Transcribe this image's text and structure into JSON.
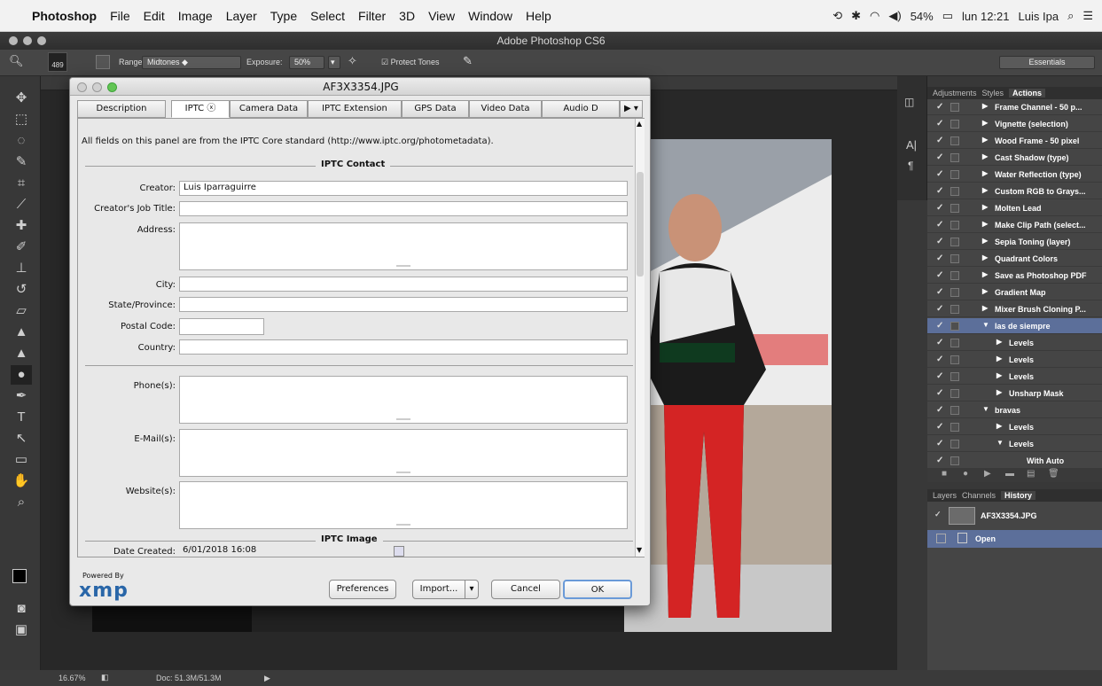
{
  "menubar": {
    "apple": "",
    "items": [
      "Photoshop",
      "File",
      "Edit",
      "Image",
      "Layer",
      "Type",
      "Select",
      "Filter",
      "3D",
      "View",
      "Window",
      "Help"
    ],
    "battery": "54%",
    "clock": "lun 12:21",
    "user": "Luis Ipa"
  },
  "window": {
    "title": "Adobe Photoshop CS6"
  },
  "options": {
    "brush_size": "489",
    "range_label": "Range:",
    "range_value": "Midtones",
    "exposure_label": "Exposure:",
    "exposure_value": "50%",
    "protect_tones": "Protect Tones",
    "workspace": "Essentials"
  },
  "status": {
    "zoom": "16.67%",
    "doc": "Doc: 51.3M/51.3M"
  },
  "panels": {
    "tabs": [
      "Adjustments",
      "Styles",
      "Actions"
    ],
    "actions": [
      {
        "label": "Frame Channel - 50 p...",
        "indent": 0,
        "open": false
      },
      {
        "label": "Vignette (selection)",
        "indent": 0,
        "open": false
      },
      {
        "label": "Wood Frame - 50 pixel",
        "indent": 0,
        "open": false
      },
      {
        "label": "Cast Shadow (type)",
        "indent": 0,
        "open": false
      },
      {
        "label": "Water Reflection (type)",
        "indent": 0,
        "open": false
      },
      {
        "label": "Custom RGB to Grays...",
        "indent": 0,
        "open": false
      },
      {
        "label": "Molten Lead",
        "indent": 0,
        "open": false
      },
      {
        "label": "Make Clip Path (select...",
        "indent": 0,
        "open": false
      },
      {
        "label": "Sepia Toning (layer)",
        "indent": 0,
        "open": false
      },
      {
        "label": "Quadrant Colors",
        "indent": 0,
        "open": false
      },
      {
        "label": "Save as Photoshop PDF",
        "indent": 0,
        "open": false
      },
      {
        "label": "Gradient Map",
        "indent": 0,
        "open": false
      },
      {
        "label": "Mixer Brush Cloning P...",
        "indent": 0,
        "open": false
      },
      {
        "label": "las de siempre",
        "indent": 0,
        "open": true
      },
      {
        "label": "Levels",
        "indent": 1,
        "open": false
      },
      {
        "label": "Levels",
        "indent": 1,
        "open": false
      },
      {
        "label": "Levels",
        "indent": 1,
        "open": false
      },
      {
        "label": "Unsharp Mask",
        "indent": 1,
        "open": false
      },
      {
        "label": "bravas",
        "indent": 0,
        "open": true
      },
      {
        "label": "Levels",
        "indent": 1,
        "open": false
      },
      {
        "label": "Levels",
        "indent": 1,
        "open": true
      },
      {
        "label": "With Auto",
        "indent": 2,
        "open": false
      }
    ],
    "lower_tabs": [
      "Layers",
      "Channels",
      "History"
    ],
    "history_snapshot": "AF3X3354.JPG",
    "history_state": "Open"
  },
  "dialog": {
    "title": "AF3X3354.JPG",
    "tabs": [
      "Description",
      "IPTC",
      "Camera Data",
      "IPTC Extension",
      "GPS Data",
      "Video Data",
      "Audio D"
    ],
    "intro": "All fields on this panel are from the IPTC Core standard (http://www.iptc.org/photometadata).",
    "section_contact": "IPTC Contact",
    "section_image": "IPTC Image",
    "labels": {
      "creator": "Creator:",
      "job_title": "Creator's Job Title:",
      "address": "Address:",
      "city": "City:",
      "state": "State/Province:",
      "postal": "Postal Code:",
      "country": "Country:",
      "phones": "Phone(s):",
      "emails": "E-Mail(s):",
      "websites": "Website(s):",
      "date_created": "Date Created:"
    },
    "values": {
      "creator": "Luis Iparraguirre",
      "date_created": "6/01/2018 16:08"
    },
    "powered_by": "Powered By",
    "xmp": "xmp",
    "buttons": {
      "preferences": "Preferences",
      "import": "Import...",
      "cancel": "Cancel",
      "ok": "OK"
    }
  }
}
